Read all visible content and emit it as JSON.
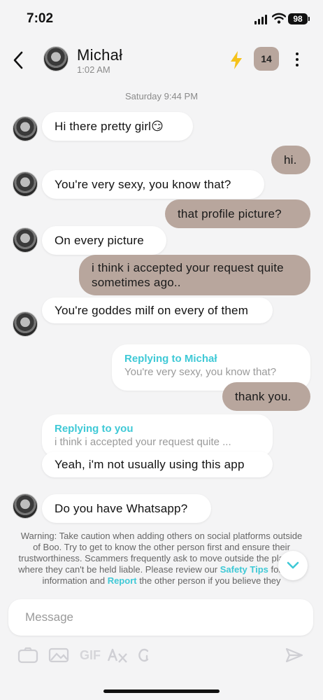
{
  "status_bar": {
    "time": "7:02",
    "battery": "98"
  },
  "header": {
    "name": "Michał",
    "subtitle": "1:02 AM",
    "count_badge": "14"
  },
  "chat": {
    "day_separator": "Saturday 9:44 PM",
    "messages": [
      {
        "from": "them",
        "text": "Hi there pretty girl😏"
      },
      {
        "from": "me",
        "text": "hi."
      },
      {
        "from": "them",
        "text": "You're very sexy, you know that?"
      },
      {
        "from": "me",
        "text": "that profile picture?"
      },
      {
        "from": "them",
        "text": "On every picture"
      },
      {
        "from": "me",
        "text": "i think i accepted your request quite sometimes ago.."
      },
      {
        "from": "them",
        "text": "You're goddes milf on every of them"
      },
      {
        "from": "me",
        "text": "thank you.",
        "reply": {
          "title": "Replying to Michał",
          "text": "You're very sexy, you know that?"
        }
      },
      {
        "from": "them",
        "text": "Yeah, i'm not usually using this app",
        "reply": {
          "title": "Replying to you",
          "text": "i think i accepted your request quite ..."
        }
      },
      {
        "from": "them",
        "text": "Do you have Whatsapp?"
      }
    ]
  },
  "warning": {
    "part1": "Warning: Take caution when adding others on social platforms outside of Boo. Try to get to know the other person first and ensure their trustworthiness. Scammers frequently ask to move outside the platform where they can't be held liable. Please review our ",
    "link1": "Safety Tips",
    "part2": " for more information and ",
    "link2": "Report",
    "part3": " the other person if you believe they"
  },
  "composer": {
    "placeholder": "Message",
    "gif_label": "GIF"
  },
  "colors": {
    "accent": "#3fc9d6",
    "outgoing_bubble": "#b8a69d",
    "bolt": "#f5c21b"
  }
}
